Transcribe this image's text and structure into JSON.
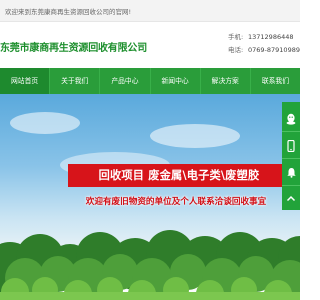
{
  "topbar": {
    "welcome": "欢迎来到东莞康商再生资源回收公司的官网!"
  },
  "header": {
    "company_name": "东莞市康商再生资源回收有限公司",
    "phone_label": "手机:",
    "phone": "13712986448",
    "tel_label": "电话:",
    "tel": "0769-87910989"
  },
  "nav": {
    "items": [
      "网站首页",
      "关于我们",
      "产品中心",
      "新闻中心",
      "解决方案",
      "联系我们"
    ],
    "active_index": 0
  },
  "banner": {
    "title": "回收项目  废金属\\电子类\\废塑胶",
    "subtitle": "欢迎有废旧物资的单位及个人联系洽谈回收事宜"
  },
  "side_toolbar": {
    "icons": [
      "qq-icon",
      "phone-icon",
      "wechat-icon",
      "back-to-top-icon"
    ]
  },
  "colors": {
    "brand_green": "#2a9d3a",
    "title_red": "#d7141a"
  }
}
